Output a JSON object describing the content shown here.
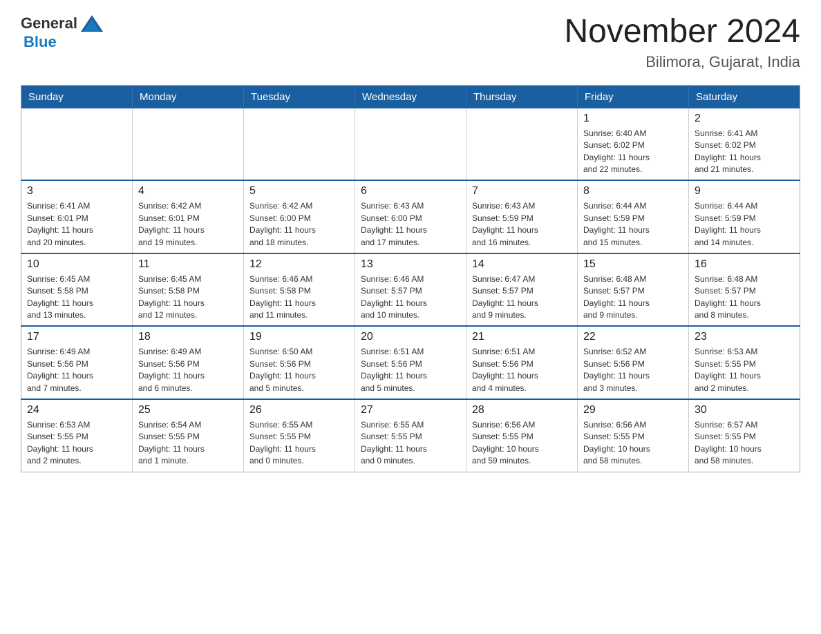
{
  "header": {
    "logo_general": "General",
    "logo_blue": "Blue",
    "title": "November 2024",
    "subtitle": "Bilimora, Gujarat, India"
  },
  "weekdays": [
    "Sunday",
    "Monday",
    "Tuesday",
    "Wednesday",
    "Thursday",
    "Friday",
    "Saturday"
  ],
  "weeks": [
    [
      {
        "day": "",
        "info": ""
      },
      {
        "day": "",
        "info": ""
      },
      {
        "day": "",
        "info": ""
      },
      {
        "day": "",
        "info": ""
      },
      {
        "day": "",
        "info": ""
      },
      {
        "day": "1",
        "info": "Sunrise: 6:40 AM\nSunset: 6:02 PM\nDaylight: 11 hours\nand 22 minutes."
      },
      {
        "day": "2",
        "info": "Sunrise: 6:41 AM\nSunset: 6:02 PM\nDaylight: 11 hours\nand 21 minutes."
      }
    ],
    [
      {
        "day": "3",
        "info": "Sunrise: 6:41 AM\nSunset: 6:01 PM\nDaylight: 11 hours\nand 20 minutes."
      },
      {
        "day": "4",
        "info": "Sunrise: 6:42 AM\nSunset: 6:01 PM\nDaylight: 11 hours\nand 19 minutes."
      },
      {
        "day": "5",
        "info": "Sunrise: 6:42 AM\nSunset: 6:00 PM\nDaylight: 11 hours\nand 18 minutes."
      },
      {
        "day": "6",
        "info": "Sunrise: 6:43 AM\nSunset: 6:00 PM\nDaylight: 11 hours\nand 17 minutes."
      },
      {
        "day": "7",
        "info": "Sunrise: 6:43 AM\nSunset: 5:59 PM\nDaylight: 11 hours\nand 16 minutes."
      },
      {
        "day": "8",
        "info": "Sunrise: 6:44 AM\nSunset: 5:59 PM\nDaylight: 11 hours\nand 15 minutes."
      },
      {
        "day": "9",
        "info": "Sunrise: 6:44 AM\nSunset: 5:59 PM\nDaylight: 11 hours\nand 14 minutes."
      }
    ],
    [
      {
        "day": "10",
        "info": "Sunrise: 6:45 AM\nSunset: 5:58 PM\nDaylight: 11 hours\nand 13 minutes."
      },
      {
        "day": "11",
        "info": "Sunrise: 6:45 AM\nSunset: 5:58 PM\nDaylight: 11 hours\nand 12 minutes."
      },
      {
        "day": "12",
        "info": "Sunrise: 6:46 AM\nSunset: 5:58 PM\nDaylight: 11 hours\nand 11 minutes."
      },
      {
        "day": "13",
        "info": "Sunrise: 6:46 AM\nSunset: 5:57 PM\nDaylight: 11 hours\nand 10 minutes."
      },
      {
        "day": "14",
        "info": "Sunrise: 6:47 AM\nSunset: 5:57 PM\nDaylight: 11 hours\nand 9 minutes."
      },
      {
        "day": "15",
        "info": "Sunrise: 6:48 AM\nSunset: 5:57 PM\nDaylight: 11 hours\nand 9 minutes."
      },
      {
        "day": "16",
        "info": "Sunrise: 6:48 AM\nSunset: 5:57 PM\nDaylight: 11 hours\nand 8 minutes."
      }
    ],
    [
      {
        "day": "17",
        "info": "Sunrise: 6:49 AM\nSunset: 5:56 PM\nDaylight: 11 hours\nand 7 minutes."
      },
      {
        "day": "18",
        "info": "Sunrise: 6:49 AM\nSunset: 5:56 PM\nDaylight: 11 hours\nand 6 minutes."
      },
      {
        "day": "19",
        "info": "Sunrise: 6:50 AM\nSunset: 5:56 PM\nDaylight: 11 hours\nand 5 minutes."
      },
      {
        "day": "20",
        "info": "Sunrise: 6:51 AM\nSunset: 5:56 PM\nDaylight: 11 hours\nand 5 minutes."
      },
      {
        "day": "21",
        "info": "Sunrise: 6:51 AM\nSunset: 5:56 PM\nDaylight: 11 hours\nand 4 minutes."
      },
      {
        "day": "22",
        "info": "Sunrise: 6:52 AM\nSunset: 5:56 PM\nDaylight: 11 hours\nand 3 minutes."
      },
      {
        "day": "23",
        "info": "Sunrise: 6:53 AM\nSunset: 5:55 PM\nDaylight: 11 hours\nand 2 minutes."
      }
    ],
    [
      {
        "day": "24",
        "info": "Sunrise: 6:53 AM\nSunset: 5:55 PM\nDaylight: 11 hours\nand 2 minutes."
      },
      {
        "day": "25",
        "info": "Sunrise: 6:54 AM\nSunset: 5:55 PM\nDaylight: 11 hours\nand 1 minute."
      },
      {
        "day": "26",
        "info": "Sunrise: 6:55 AM\nSunset: 5:55 PM\nDaylight: 11 hours\nand 0 minutes."
      },
      {
        "day": "27",
        "info": "Sunrise: 6:55 AM\nSunset: 5:55 PM\nDaylight: 11 hours\nand 0 minutes."
      },
      {
        "day": "28",
        "info": "Sunrise: 6:56 AM\nSunset: 5:55 PM\nDaylight: 10 hours\nand 59 minutes."
      },
      {
        "day": "29",
        "info": "Sunrise: 6:56 AM\nSunset: 5:55 PM\nDaylight: 10 hours\nand 58 minutes."
      },
      {
        "day": "30",
        "info": "Sunrise: 6:57 AM\nSunset: 5:55 PM\nDaylight: 10 hours\nand 58 minutes."
      }
    ]
  ]
}
